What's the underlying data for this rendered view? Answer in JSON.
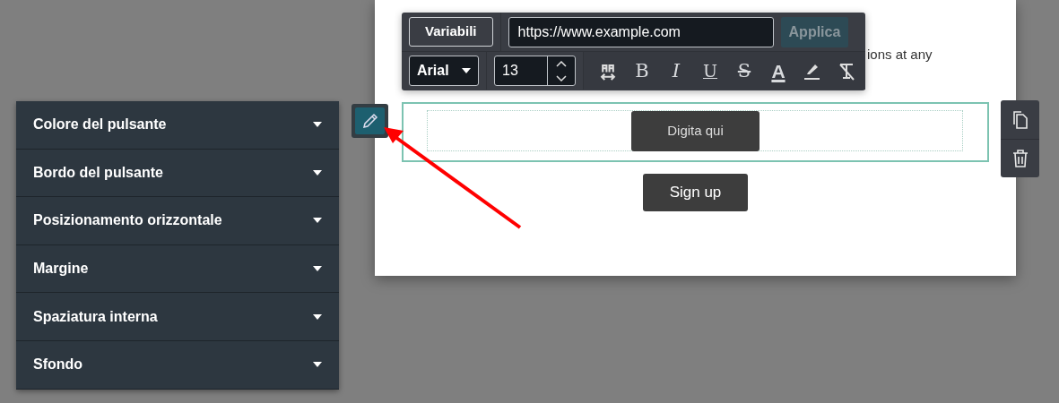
{
  "toolbar": {
    "variables_button": "Variabili",
    "url_field": {
      "value": "https://www.example.com"
    },
    "apply_button": {
      "label": "Applica",
      "disabled": true
    },
    "font_select": "Arial",
    "font_size": "13",
    "format_buttons": [
      {
        "kind": "swap"
      },
      {
        "kind": "bold",
        "label": "B"
      },
      {
        "kind": "italic",
        "label": "I"
      },
      {
        "kind": "underline",
        "label": "U"
      },
      {
        "kind": "strike",
        "label": "S"
      },
      {
        "kind": "color",
        "label": "A"
      },
      {
        "kind": "highlight"
      },
      {
        "kind": "clear"
      }
    ]
  },
  "page_text": "ions at any",
  "buttons": [
    {
      "label": "Digita qui",
      "selected": true
    },
    {
      "label": "Sign up",
      "selected": false
    }
  ],
  "settings_panel": [
    {
      "label": "Colore del pulsante",
      "expanded": false
    },
    {
      "label": "Bordo del pulsante",
      "expanded": false
    },
    {
      "label": "Posizionamento orizzontale",
      "expanded": false
    },
    {
      "label": "Margine",
      "expanded": false
    },
    {
      "label": "Spaziatura interna",
      "expanded": false
    },
    {
      "label": "Sfondo",
      "expanded": false
    }
  ]
}
